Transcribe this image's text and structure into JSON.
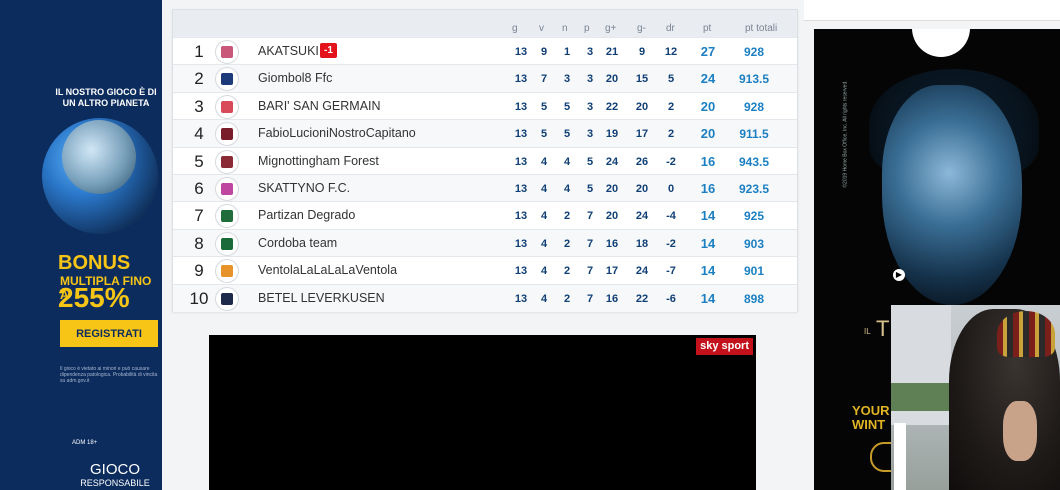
{
  "left_ad": {
    "headline": "IL NOSTRO GIOCO È DI UN ALTRO PIANETA",
    "bonus": "BONUS",
    "bonus_sub": "MULTIPLA FINO A",
    "percent": "255%",
    "cta": "REGISTRATI",
    "legal": "Il gioco è vietato ai minori e può causare dipendenza patologica. Probabilità di vincita su adm.gov.it",
    "adm": "ADM 18+",
    "gioco": "GIOCO",
    "responsabile": "RESPONSABILE"
  },
  "standings": {
    "headers": {
      "g": "g",
      "v": "v",
      "n": "n",
      "p": "p",
      "gp": "g+",
      "gm": "g-",
      "dr": "dr",
      "pt": "pt",
      "tot": "pt totali"
    },
    "rows": [
      {
        "pos": "1",
        "team": "AKATSUKI",
        "penalty": "-1",
        "g": "13",
        "v": "9",
        "n": "1",
        "p": "3",
        "gp": "21",
        "gm": "9",
        "dr": "12",
        "pt": "27",
        "tot": "928",
        "color": "#c9577a"
      },
      {
        "pos": "2",
        "team": "Giombol8 Ffc",
        "g": "13",
        "v": "7",
        "n": "3",
        "p": "3",
        "gp": "20",
        "gm": "15",
        "dr": "5",
        "pt": "24",
        "tot": "913.5",
        "color": "#1d3a7a"
      },
      {
        "pos": "3",
        "team": "BARI' SAN GERMAIN",
        "g": "13",
        "v": "5",
        "n": "5",
        "p": "3",
        "gp": "22",
        "gm": "20",
        "dr": "2",
        "pt": "20",
        "tot": "928",
        "color": "#d84a5a"
      },
      {
        "pos": "4",
        "team": "FabioLucioniNostroCapitano",
        "g": "13",
        "v": "5",
        "n": "5",
        "p": "3",
        "gp": "19",
        "gm": "17",
        "dr": "2",
        "pt": "20",
        "tot": "911.5",
        "color": "#7a1d2a"
      },
      {
        "pos": "5",
        "team": "Mignottingham Forest",
        "g": "13",
        "v": "4",
        "n": "4",
        "p": "5",
        "gp": "24",
        "gm": "26",
        "dr": "-2",
        "pt": "16",
        "tot": "943.5",
        "color": "#8a2a35"
      },
      {
        "pos": "6",
        "team": "SKATTYNO F.C.",
        "g": "13",
        "v": "4",
        "n": "4",
        "p": "5",
        "gp": "20",
        "gm": "20",
        "dr": "0",
        "pt": "16",
        "tot": "923.5",
        "color": "#c047a0"
      },
      {
        "pos": "7",
        "team": "Partizan Degrado",
        "g": "13",
        "v": "4",
        "n": "2",
        "p": "7",
        "gp": "20",
        "gm": "24",
        "dr": "-4",
        "pt": "14",
        "tot": "925",
        "color": "#1f6b3a"
      },
      {
        "pos": "8",
        "team": "Cordoba team",
        "g": "13",
        "v": "4",
        "n": "2",
        "p": "7",
        "gp": "16",
        "gm": "18",
        "dr": "-2",
        "pt": "14",
        "tot": "903",
        "color": "#1a6a3a"
      },
      {
        "pos": "9",
        "team": "VentolaLaLaLaLaVentola",
        "g": "13",
        "v": "4",
        "n": "2",
        "p": "7",
        "gp": "17",
        "gm": "24",
        "dr": "-7",
        "pt": "14",
        "tot": "901",
        "color": "#e8922a"
      },
      {
        "pos": "10",
        "team": "BETEL LEVERKUSEN",
        "g": "13",
        "v": "4",
        "n": "2",
        "p": "7",
        "gp": "16",
        "gm": "22",
        "dr": "-6",
        "pt": "14",
        "tot": "898",
        "color": "#1d2a4a"
      }
    ]
  },
  "video": {
    "logo": "sky sport"
  },
  "right_ad": {
    "tiny": "©2019 Home Box Office, Inc. All rights reserved.",
    "il": "IL",
    "trono": "TR",
    "your": "YOUR",
    "wint": "WINT"
  }
}
